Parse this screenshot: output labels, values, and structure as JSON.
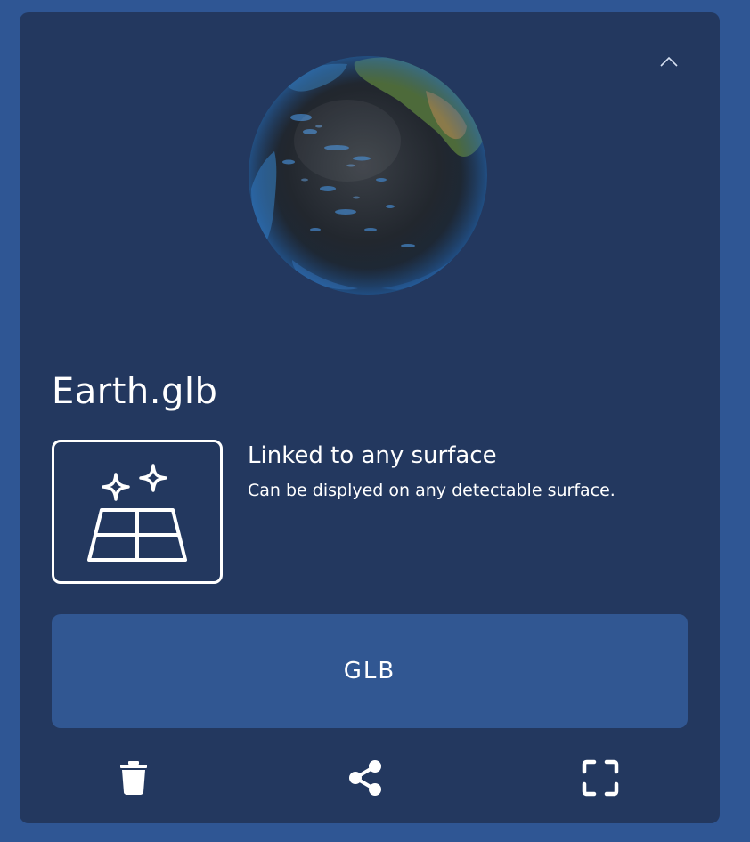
{
  "model": {
    "file_name": "Earth.glb",
    "preview_icon": "globe-preview"
  },
  "placement": {
    "icon": "surface-sparkle-icon",
    "title": "Linked to any surface",
    "description": "Can be displyed on any detectable surface."
  },
  "format_button": {
    "label": "GLB"
  },
  "actions": {
    "collapse_icon": "chevron-up-icon",
    "delete_icon": "trash-icon",
    "share_icon": "share-icon",
    "fullscreen_icon": "fullscreen-icon"
  },
  "colors": {
    "page_background": "#2f5694",
    "card_background": "#23385f",
    "button_background": "#315792",
    "text": "#ffffff"
  }
}
